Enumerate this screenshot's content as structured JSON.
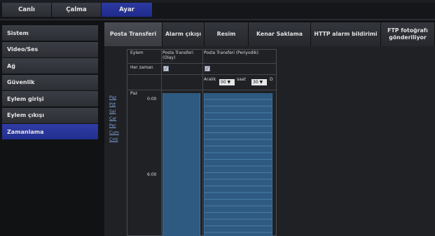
{
  "topnav": {
    "tabs": [
      {
        "label": "Canlı"
      },
      {
        "label": "Çalma"
      },
      {
        "label": "Ayar"
      }
    ]
  },
  "sidebar": {
    "items": [
      {
        "label": "Sistem"
      },
      {
        "label": "Video/Ses"
      },
      {
        "label": "Ağ"
      },
      {
        "label": "Güvenlik"
      },
      {
        "label": "Eylem girişi"
      },
      {
        "label": "Eylem çıkışı"
      },
      {
        "label": "Zamanlama"
      }
    ]
  },
  "content_tabs": [
    {
      "label": "Posta Transferi"
    },
    {
      "label": "Alarm çıkışı"
    },
    {
      "label": "Resim"
    },
    {
      "label": "Kenar Saklama"
    },
    {
      "label": "HTTP alarm bildirimi"
    },
    {
      "label": "FTP fotoğrafı gönderiliyor"
    }
  ],
  "schedule": {
    "header_action": "Eylem",
    "col1_title": "Posta Transferi (Olay)",
    "col2_title": "Posta Transferi (Periyodik)",
    "always_label": "Her zaman",
    "interval_label": "Aralık",
    "interval_hours": "00",
    "hour_label": "saat",
    "interval_minutes": "30",
    "interval_suffix": "D",
    "day_label": "Paz",
    "time_0": "0:00",
    "time_6": "6:00",
    "days": [
      "Paz",
      "Pzt",
      "Sal",
      "Çar",
      "Per",
      "Cum",
      "Cmt"
    ]
  }
}
